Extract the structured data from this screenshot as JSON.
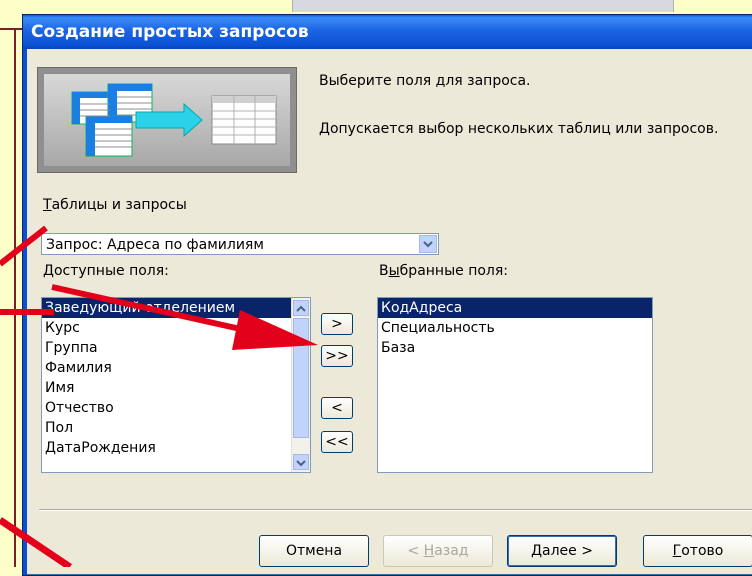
{
  "window": {
    "title": "Создание простых запросов"
  },
  "instructions": {
    "line1": "Выберите поля для запроса.",
    "line2": "Допускается выбор нескольких таблиц или запросов."
  },
  "tables": {
    "label_first": "Т",
    "label_rest": "аблицы и запросы",
    "selected": "Запрос: Адреса по фамилиям"
  },
  "available": {
    "label_first": "Д",
    "label_rest": "оступные поля:",
    "items": [
      "Заведующий отделением",
      "Курс",
      "Группа",
      "Фамилия",
      "Имя",
      "Отчество",
      "Пол",
      "ДатаРождения"
    ]
  },
  "selected_fields": {
    "label_pre": "В",
    "label_under": "ы",
    "label_rest": "бранные поля:",
    "items": [
      "КодАдреса",
      "Специальность",
      "База"
    ]
  },
  "move_buttons": {
    "add_one": ">",
    "add_all": ">>",
    "remove_one": "<",
    "remove_all": "<<"
  },
  "footer": {
    "cancel": "Отмена",
    "back_pre": "< ",
    "back_under": "Н",
    "back_rest": "азад",
    "next_under": "Д",
    "next_rest": "алее >",
    "finish_under": "Г",
    "finish_rest": "отово"
  },
  "colors": {
    "title_bar": "#0a50d4",
    "selection": "#0a246a",
    "arrow": "#e3001b",
    "slide_bg": "#fefec8"
  }
}
